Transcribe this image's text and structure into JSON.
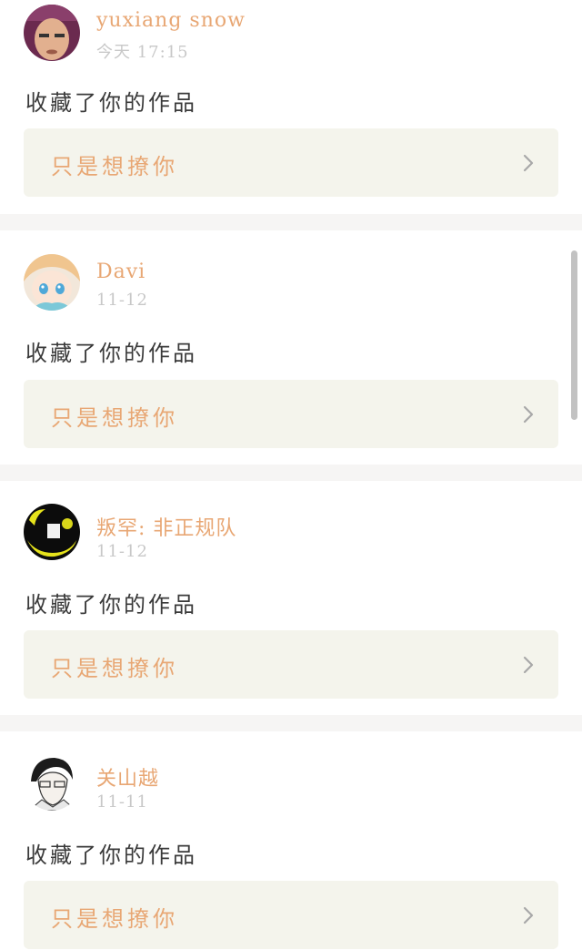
{
  "feed": {
    "items": [
      {
        "user": "yuxiang snow",
        "time": "今天 17:15",
        "action": "收藏了你的作品",
        "work_title": "只是想撩你",
        "avatar": "photo-avatar-man"
      },
      {
        "user": "Davi",
        "time": "11-12",
        "action": "收藏了你的作品",
        "work_title": "只是想撩你",
        "avatar": "anime-girl-avatar"
      },
      {
        "user": "叛罕: 非正规队",
        "time": "11-12",
        "action": "收藏了你的作品",
        "work_title": "只是想撩你",
        "avatar": "yellow-black-avatar"
      },
      {
        "user": "关山越",
        "time": "11-11",
        "action": "收藏了你的作品",
        "work_title": "只是想撩你",
        "avatar": "sketch-character-avatar"
      }
    ]
  },
  "icons": {
    "chevron": "chevron-right-icon"
  },
  "colors": {
    "accent": "#e8a774",
    "timestamp": "#c8c8c8",
    "body_text": "#3a3a3a",
    "link_bg": "#f4f4ec",
    "separator": "#f6f5f4"
  }
}
